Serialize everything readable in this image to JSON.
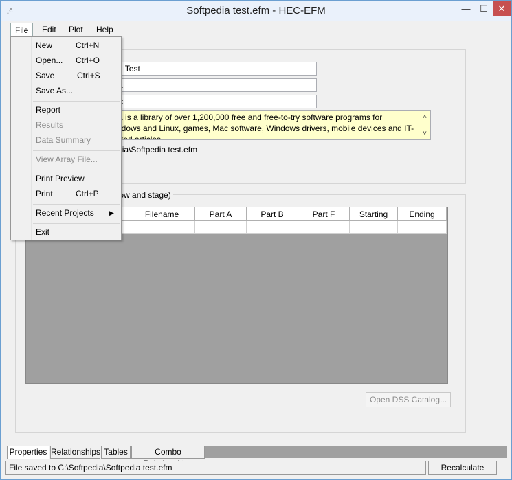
{
  "window": {
    "title": "Softpedia test.efm - HEC-EFM",
    "icon_glyph": "¸c",
    "minimize_glyph": "—",
    "maximize_glyph": "☐",
    "close_glyph": "✕"
  },
  "menubar": {
    "file": "File",
    "edit": "Edit",
    "plot": "Plot",
    "help": "Help"
  },
  "file_menu": {
    "items": [
      {
        "label": "New",
        "shortcut": "Ctrl+N"
      },
      {
        "label": "Open...",
        "shortcut": "Ctrl+O"
      },
      {
        "label": "Save",
        "shortcut": "Ctrl+S"
      },
      {
        "label": "Save As..."
      },
      {
        "label": "Report"
      },
      {
        "label": "Results",
        "disabled": true
      },
      {
        "label": "Data Summary",
        "disabled": true
      },
      {
        "label": "View Array File...",
        "disabled": true
      },
      {
        "label": "Print Preview"
      },
      {
        "label": "Print",
        "shortcut": "Ctrl+P"
      },
      {
        "label": "Recent Projects",
        "submenu_arrow": "▶"
      },
      {
        "label": "Exit"
      }
    ]
  },
  "properties": {
    "name_value": "edia Test",
    "analyst_value": "edia",
    "location_value": "York",
    "description_value": "edia is a library of over 1,200,000 free and free-to-try software programs for Windows and Linux, games, Mac software, Windows drivers, mobile devices and IT-related articles.",
    "description_scroll_up": "˄",
    "description_scroll_down": "˅",
    "path_value": "ftpedia\\Softpedia test.efm"
  },
  "dss_group": {
    "label": "of flow and stage)",
    "columns": [
      "Filename",
      "Part A",
      "Part B",
      "Part F",
      "Starting",
      "Ending"
    ],
    "open_dss_button": "Open DSS Catalog..."
  },
  "tabs": [
    {
      "label": "Properties",
      "active": true
    },
    {
      "label": "Relationships"
    },
    {
      "label": "Tables"
    },
    {
      "label": "Combo Relationships"
    }
  ],
  "status": {
    "message": "File saved to C:\\Softpedia\\Softpedia test.efm",
    "recalculate_button": "Recalculate"
  },
  "colors": {
    "description_bg": "#ffffcc",
    "grid_bg": "#a0a0a0",
    "close_button": "#c75050"
  }
}
